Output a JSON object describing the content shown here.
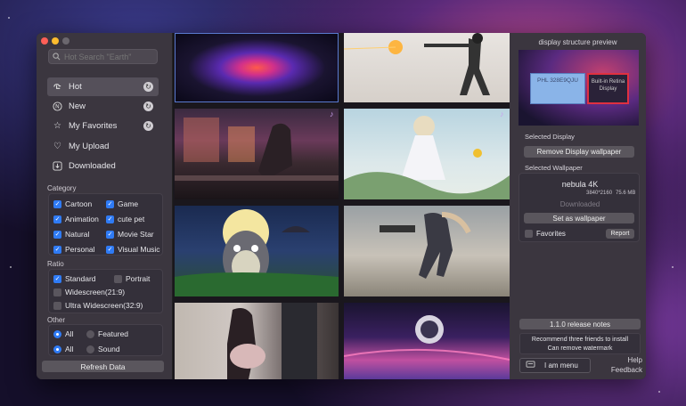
{
  "search": {
    "placeholder": "Hot Search \"Earth\""
  },
  "nav": [
    {
      "label": "Hot"
    },
    {
      "label": "New"
    },
    {
      "label": "My Favorites"
    },
    {
      "label": "My Upload"
    },
    {
      "label": "Downloaded"
    }
  ],
  "category": {
    "title": "Category",
    "options": [
      "Cartoon",
      "Game",
      "Animation",
      "cute pet",
      "Natural",
      "Movie Star",
      "Personal",
      "Visual Music"
    ]
  },
  "ratio": {
    "title": "Ratio",
    "options": [
      "Standard",
      "Portrait",
      "Widescreen(21:9)",
      "Ultra Widescreen(32:9)"
    ]
  },
  "other": {
    "title": "Other",
    "row1": [
      "All",
      "Featured"
    ],
    "row2": [
      "All",
      "Sound"
    ]
  },
  "refresh_label": "Refresh Data",
  "right": {
    "title": "display structure preview",
    "display1": "PHL 328E9QJU",
    "display2": "Built-in Retina Display",
    "selected_display": "Selected Display",
    "remove_label": "Remove Display wallpaper",
    "selected_wallpaper": "Selected Wallpaper",
    "wp_name": "nebula 4K",
    "wp_res": "3840*2160",
    "wp_size": "75.6 MB",
    "wp_status": "Downloaded",
    "set_label": "Set as wallpaper",
    "favorites_label": "Favorites",
    "report_label": "Report",
    "release_label": "1.1.0 release notes",
    "recommend1": "Recommend three friends to install",
    "recommend2": "Can remove watermark",
    "menu_label": "I am menu",
    "help": "Help",
    "feedback": "Feedback"
  },
  "colors": {
    "accent": "#2f7bf5",
    "sidebar": "#3b363f"
  }
}
